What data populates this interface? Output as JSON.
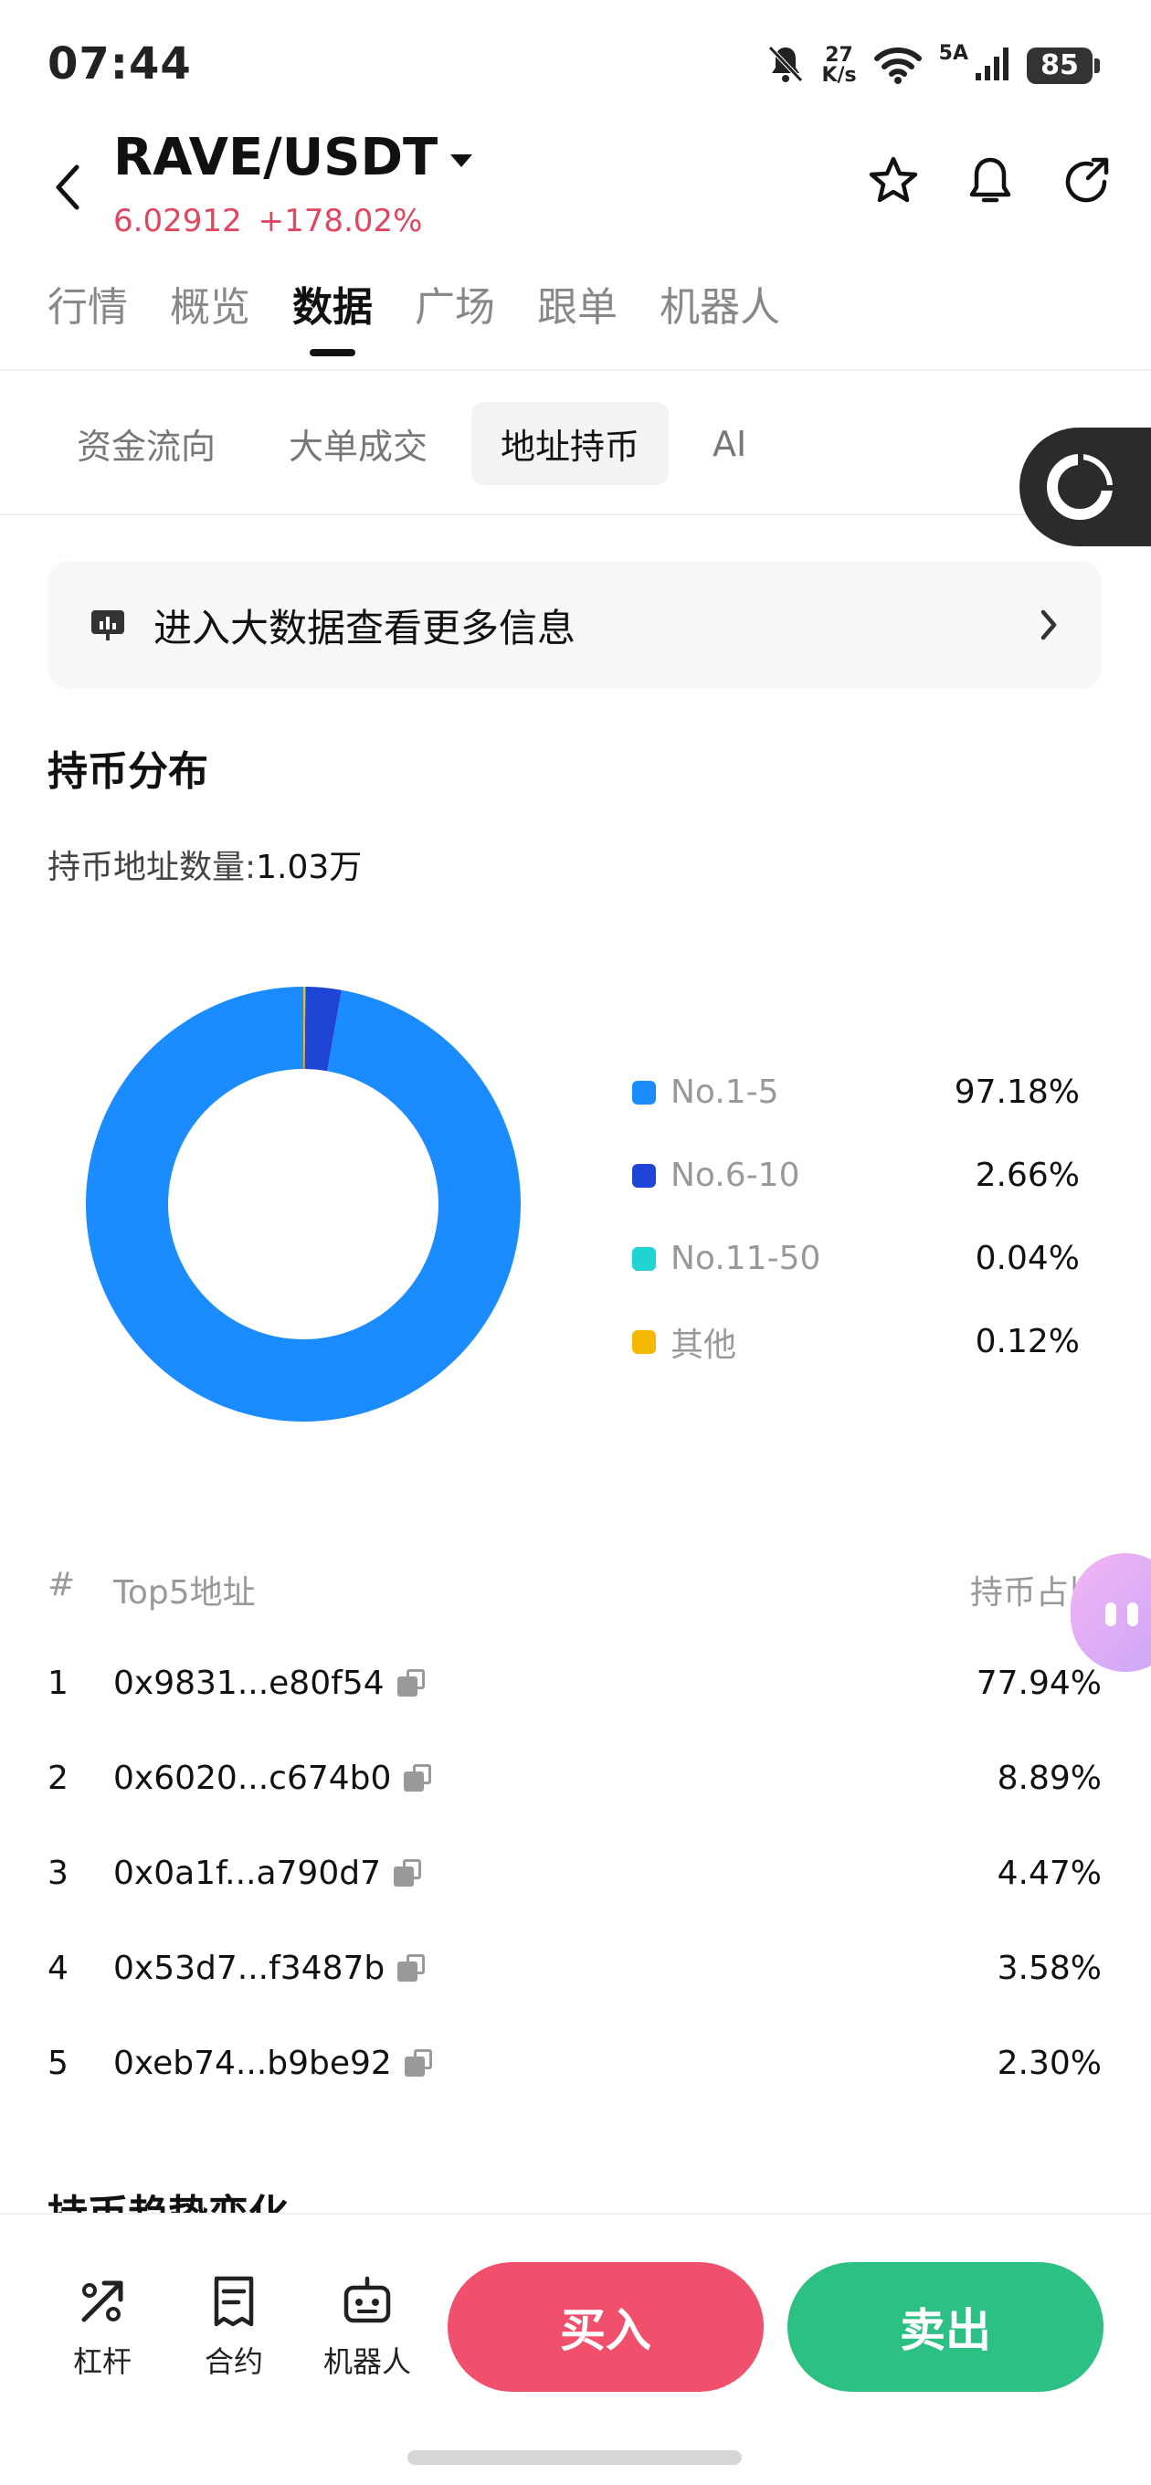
{
  "status_bar": {
    "time": "07:44",
    "net_speed_value": "27",
    "net_speed_unit": "K/s",
    "signal_label": "5A",
    "battery": "85"
  },
  "header": {
    "pair": "RAVE/USDT",
    "price": "6.02912",
    "change": "+178.02%",
    "price_color": "#e2455f"
  },
  "main_tabs": [
    "行情",
    "概览",
    "数据",
    "广场",
    "跟单",
    "机器人"
  ],
  "sub_tabs": [
    "资金流向",
    "大单成交",
    "地址持币",
    "AI"
  ],
  "banner": {
    "text": "进入大数据查看更多信息"
  },
  "distribution": {
    "title": "持币分布",
    "count_label": "持币地址数量:",
    "count_value": "1.03万"
  },
  "chart_data": {
    "type": "pie",
    "categories": [
      "No.1-5",
      "No.6-10",
      "No.11-50",
      "其他"
    ],
    "values": [
      97.18,
      2.66,
      0.04,
      0.12
    ],
    "display_values": [
      "97.18%",
      "2.66%",
      "0.04%",
      "0.12%"
    ],
    "colors": [
      "#1a8cff",
      "#1f45d6",
      "#22d3d3",
      "#f5b800"
    ],
    "style": "donut",
    "legend_position": "right"
  },
  "top5": {
    "col_num": "#",
    "col_addr": "Top5地址",
    "col_pct": "持币占比",
    "rows": [
      {
        "num": "1",
        "addr": "0x9831...e80f54",
        "pct": "77.94%"
      },
      {
        "num": "2",
        "addr": "0x6020...c674b0",
        "pct": "8.89%"
      },
      {
        "num": "3",
        "addr": "0x0a1f...a790d7",
        "pct": "4.47%"
      },
      {
        "num": "4",
        "addr": "0x53d7...f3487b",
        "pct": "3.58%"
      },
      {
        "num": "5",
        "addr": "0xeb74...b9be92",
        "pct": "2.30%"
      }
    ]
  },
  "next_section_title": "持币趋势变化",
  "bottom_bar": {
    "tools": [
      "杠杆",
      "合约",
      "机器人"
    ],
    "buy": "买入",
    "sell": "卖出",
    "buy_color": "#f0506b",
    "sell_color": "#2dc084"
  }
}
